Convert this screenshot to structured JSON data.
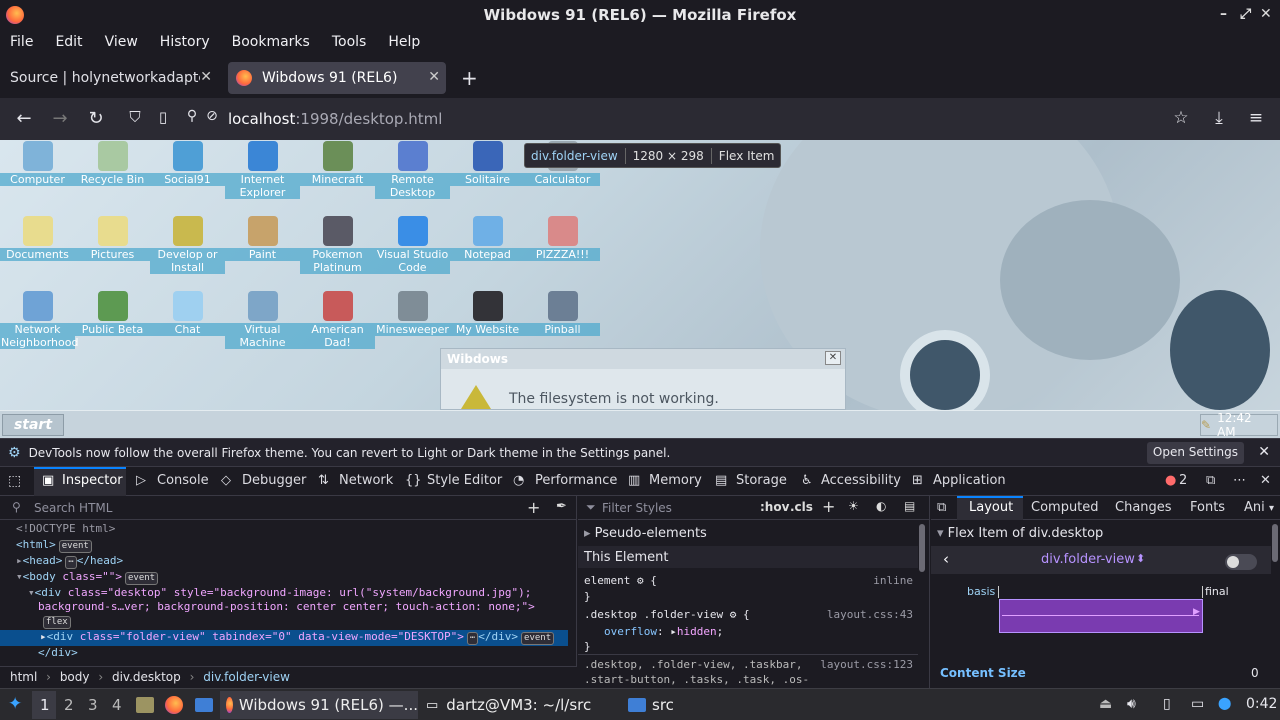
{
  "window": {
    "title": "Wibdows 91 (REL6) — Mozilla Firefox"
  },
  "menu": [
    "File",
    "Edit",
    "View",
    "History",
    "Bookmarks",
    "Tools",
    "Help"
  ],
  "tabs": [
    {
      "label": "Source | holynetworkadapte"
    },
    {
      "label": "Wibdows 91 (REL6)"
    }
  ],
  "url": {
    "host": "localhost",
    "rest": ":1998/desktop.html"
  },
  "inspector_tip": {
    "element": "div.folder-view",
    "size": "1280 × 298",
    "kind": "Flex Item"
  },
  "desktop_icons": [
    {
      "label": "Computer",
      "color": "#7fb3d9"
    },
    {
      "label": "Recycle Bin",
      "color": "#a9c9a2"
    },
    {
      "label": "Social91",
      "color": "#4f9fd6"
    },
    {
      "label": "Internet Explorer",
      "color": "#3b86d6"
    },
    {
      "label": "Minecraft",
      "color": "#6b8f58"
    },
    {
      "label": "Remote Desktop",
      "color": "#5b7fd0"
    },
    {
      "label": "Solitaire",
      "color": "#3a66b8"
    },
    {
      "label": "Calculator",
      "color": "#9aa7b0"
    },
    {
      "label": "Documents",
      "color": "#e8dc8e"
    },
    {
      "label": "Pictures",
      "color": "#e8dc8e"
    },
    {
      "label": "Develop or Install",
      "color": "#c9b94e"
    },
    {
      "label": "Paint",
      "color": "#c7a36b"
    },
    {
      "label": "Pokemon Platinum",
      "color": "#5a5a66"
    },
    {
      "label": "Visual Studio Code",
      "color": "#3a8ee6"
    },
    {
      "label": "Notepad",
      "color": "#6fb0e6"
    },
    {
      "label": "PIZZZA!!!",
      "color": "#d98a8a"
    },
    {
      "label": "Network Neighborhood",
      "color": "#6fa3d6"
    },
    {
      "label": "Public Beta",
      "color": "#5d9a52"
    },
    {
      "label": "Chat",
      "color": "#9fd0f0"
    },
    {
      "label": "Virtual Machine",
      "color": "#7ea6c8"
    },
    {
      "label": "American Dad!",
      "color": "#c85a5a"
    },
    {
      "label": "Minesweeper",
      "color": "#7f8d97"
    },
    {
      "label": "My Website",
      "color": "#333338"
    },
    {
      "label": "Pinball",
      "color": "#6c7f95"
    }
  ],
  "dialog": {
    "title": "Wibdows",
    "message": "The filesystem is not working.",
    "close": "✕"
  },
  "taskbar": {
    "start": "start",
    "clock": "12:42 AM"
  },
  "notice": {
    "text": "DevTools now follow the overall Firefox theme. You can revert to Light or Dark theme in the Settings panel.",
    "button": "Open Settings"
  },
  "devtools_tabs": [
    "Inspector",
    "Console",
    "Debugger",
    "Network",
    "Style Editor",
    "Performance",
    "Memory",
    "Storage",
    "Accessibility",
    "Application"
  ],
  "error_count": "2",
  "html_search_placeholder": "Search HTML",
  "html_lines": [
    {
      "text": "<!DOCTYPE html>"
    },
    {
      "open": "<html>",
      "badge": "event"
    },
    {
      "open": "<head>",
      "mid": "⋯",
      "close": "</head>"
    },
    {
      "open": "<body",
      "attrs": " class=\"\">",
      "badge": "event"
    },
    {
      "open": "<div",
      "attrs": " class=\"desktop\" style=\"background-image: url(\"system/background.jpg\");"
    },
    {
      "text": "background-s…ver; background-position: center center; touch-action: none;\">"
    },
    {
      "badge": "flex"
    },
    {
      "open": "<div",
      "attrs": " class=\"folder-view\" tabindex=\"0\" data-view-mode=\"DESKTOP\">",
      "mid": "⋯",
      "close": "</div>",
      "badge": "event"
    },
    {
      "text": "</div>"
    }
  ],
  "breadcrumb": [
    "html",
    "body",
    "div.desktop",
    "div.folder-view"
  ],
  "rules": {
    "filter_placeholder": "Filter Styles",
    "hov": ":hov",
    "cls": ".cls",
    "pseudo": "Pseudo-elements",
    "this_element": "This Element",
    "element_rule": "element",
    "inline": "inline",
    "rule1_sel": ".desktop .folder-view",
    "rule1_src": "layout.css:43",
    "rule1_prop": "overflow",
    "rule1_val": "hidden",
    "rule2_sel": ".desktop, .folder-view, .taskbar,",
    "rule2_sel2": ".start-button, .tasks, .task, .os-",
    "rule2_src": "layout.css:123"
  },
  "layout_panel": {
    "tabs": [
      "Layout",
      "Computed",
      "Changes",
      "Fonts",
      "Ani"
    ],
    "flex_header": "Flex Item of div.desktop",
    "item": "div.folder-view",
    "basis": "basis",
    "final": "final",
    "content_size": "Content Size",
    "content_value": "0",
    "bar_color": "#7a3bb0"
  },
  "os_taskbar": {
    "workspaces": [
      "1",
      "2",
      "3",
      "4"
    ],
    "tasks": [
      "Wibdows 91 (REL6) —...",
      "dartz@VM3: ~/l/src",
      "src"
    ],
    "time": "0:42"
  }
}
